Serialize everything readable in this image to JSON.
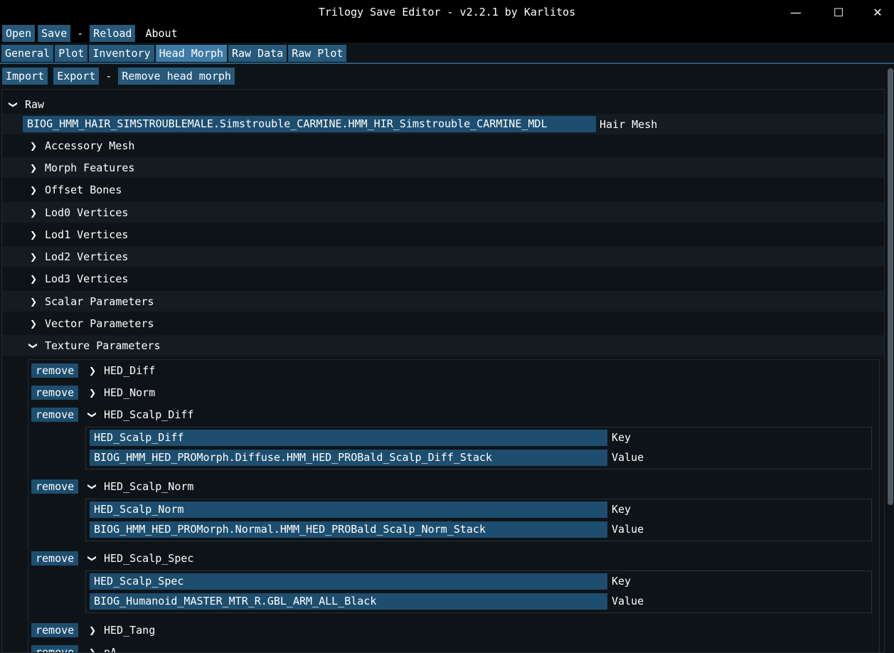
{
  "window": {
    "title": "Trilogy Save Editor - v2.2.1 by Karlitos",
    "minimize_glyph": "—",
    "maximize_glyph": "☐",
    "close_glyph": "✕"
  },
  "menu": {
    "open": "Open",
    "save": "Save",
    "sep": "-",
    "reload": "Reload",
    "about": "About"
  },
  "tabs": [
    "General",
    "Plot",
    "Inventory",
    "Head Morph",
    "Raw Data",
    "Raw Plot"
  ],
  "active_tab": "Head Morph",
  "toolbar": {
    "import": "Import",
    "export": "Export",
    "sep": "-",
    "remove_head_morph": "Remove head morph"
  },
  "tree": {
    "root_label": "Raw",
    "hair_mesh_value": "BIOG_HMM_HAIR_SIMSTROUBLEMALE.Simstrouble_CARMINE.HMM_HIR_Simstrouble_CARMINE_MDL",
    "hair_mesh_label": "Hair Mesh",
    "collapsed_nodes": [
      "Accessory Mesh",
      "Morph Features",
      "Offset Bones",
      "Lod0 Vertices",
      "Lod1 Vertices",
      "Lod2 Vertices",
      "Lod3 Vertices",
      "Scalar Parameters",
      "Vector Parameters"
    ],
    "texture_parameters_label": "Texture Parameters",
    "remove_label": "remove",
    "key_label": "Key",
    "value_label": "Value",
    "textures": [
      {
        "name": "HED_Diff"
      },
      {
        "name": "HED_Norm"
      },
      {
        "name": "HED_Scalp_Diff",
        "key": "HED_Scalp_Diff",
        "value": "BIOG_HMM_HED_PROMorph.Diffuse.HMM_HED_PROBald_Scalp_Diff_Stack"
      },
      {
        "name": "HED_Scalp_Norm",
        "key": "HED_Scalp_Norm",
        "value": "BIOG_HMM_HED_PROMorph.Normal.HMM_HED_PROBald_Scalp_Norm_Stack"
      },
      {
        "name": "HED_Scalp_Spec",
        "key": "HED_Scalp_Spec",
        "value": "BIOG_Humanoid_MASTER_MTR_R.GBL_ARM_ALL_Black"
      },
      {
        "name": "HED_Tang"
      },
      {
        "name": "nA"
      }
    ]
  }
}
